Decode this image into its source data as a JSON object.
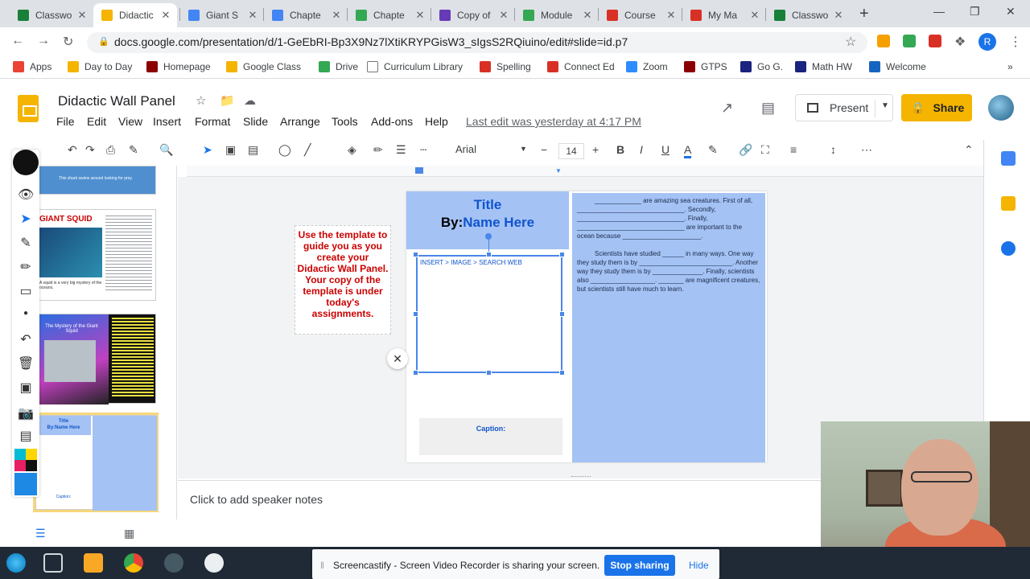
{
  "browser": {
    "tabs": [
      {
        "title": "Classwo",
        "color": "#188038"
      },
      {
        "title": "Didactic",
        "color": "#f4b400"
      },
      {
        "title": "Giant S",
        "color": "#4285f4"
      },
      {
        "title": "Chapte",
        "color": "#4285f4"
      },
      {
        "title": "Chapte",
        "color": "#34a853"
      },
      {
        "title": "Copy of",
        "color": "#673ab7"
      },
      {
        "title": "Module",
        "color": "#34a853"
      },
      {
        "title": "Course",
        "color": "#d93025"
      },
      {
        "title": "My Ma",
        "color": "#d93025"
      },
      {
        "title": "Classwo",
        "color": "#188038"
      }
    ],
    "url": "docs.google.com/presentation/d/1-GeEbRI-Bp3X9Nz7lXtiKRYPGisW3_sIgsS2RQiuino/edit#slide=id.p7",
    "profile_initial": "R"
  },
  "bookmarks": [
    {
      "label": "Apps",
      "color": "#ea4335"
    },
    {
      "label": "Day to Day",
      "color": "#f4b400"
    },
    {
      "label": "Homepage",
      "color": "#8b0000"
    },
    {
      "label": "Google Class",
      "color": "#f4b400"
    },
    {
      "label": "Drive",
      "color": "#34a853"
    },
    {
      "label": "Curriculum Library",
      "color": "#ffffff"
    },
    {
      "label": "Spelling",
      "color": "#d93025"
    },
    {
      "label": "Connect Ed",
      "color": "#d93025"
    },
    {
      "label": "Zoom",
      "color": "#2d8cff"
    },
    {
      "label": "GTPS",
      "color": "#8b0000"
    },
    {
      "label": "Go G.",
      "color": "#1a237e"
    },
    {
      "label": "Math HW",
      "color": "#1a237e"
    },
    {
      "label": "Welcome",
      "color": "#1565c0"
    }
  ],
  "doc": {
    "title": "Didactic Wall Panel",
    "menus": [
      "File",
      "Edit",
      "View",
      "Insert",
      "Format",
      "Slide",
      "Arrange",
      "Tools",
      "Add-ons",
      "Help"
    ],
    "last_edit": "Last edit was yesterday at 4:17 PM",
    "present_label": "Present",
    "share_label": "Share"
  },
  "toolbar": {
    "font": "Arial",
    "font_size": "14"
  },
  "slide": {
    "title": "Title",
    "by_prefix": "By:",
    "by_name": "Name Here",
    "image_hint": "INSERT > IMAGE > SEARCH WEB",
    "caption": "Caption:",
    "paragraph1": "_____________ are amazing sea creatures. First of all, ______________________________. Secondly, ______________________________. Finally, ______________________________ are important to the ocean because ______________________.",
    "paragraph2": "Scientists have studied ______ in many ways. One way they study them is by __________________________. Another way they study them is by ______________. Finally, scientists also __________________. _______ are magnificent creatures, but scientists still have much to learn.",
    "instructions": "Use the template to guide you as you create your Didactic Wall Panel. Your copy of the template is under today's assignments."
  },
  "filmstrip": {
    "slide_a_caption": "This shark swims around looking for prey.",
    "slide_b_title": "GIANT SQUID",
    "slide_b_caption": "A squid is a very big mystery of the oceans.",
    "slide_c_title": "The Mystery of the Giant Squid",
    "slide_d_title": "Title",
    "slide_d_by": "By:Name Here",
    "slide_d_caption": "Caption:"
  },
  "notes": {
    "placeholder": "Click to add speaker notes"
  },
  "banner": {
    "text": "Screencastify - Screen Video Recorder is sharing your screen.",
    "stop_label": "Stop sharing",
    "hide_label": "Hide"
  }
}
